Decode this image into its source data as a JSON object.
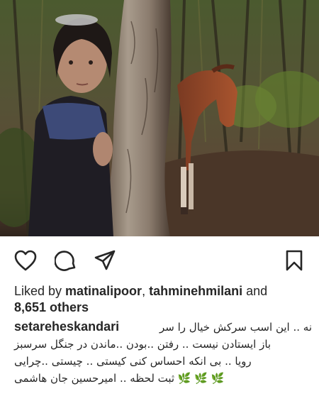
{
  "post": {
    "photo_alt": "",
    "actions": {
      "like_icon": "heart-outline-icon",
      "comment_icon": "comment-bubble-icon",
      "share_icon": "paper-plane-icon",
      "save_icon": "bookmark-icon"
    },
    "likes": {
      "prefix": "Liked by ",
      "user1": "matinalipoor",
      "separator": ", ",
      "user2": "tahminehmilani",
      "and": " and",
      "count": "8,651 others"
    },
    "caption": {
      "username": "setareheskandari",
      "line1": "نه .. این اسب سرکش خیال را سر",
      "line2": "باز ایستادن نیست .. رفتن ..بودن ..ماندن در جنگل سرسبز",
      "line3": "رویا .. بی انکه احساس کنی کیستی .. چیستی ..چرایی",
      "line4": "🌿 🌿 🌿 ثبت لحظه .. امیرحسین جان هاشمی"
    }
  },
  "colors": {
    "text": "#262626",
    "leaf": "#6ba43a"
  }
}
